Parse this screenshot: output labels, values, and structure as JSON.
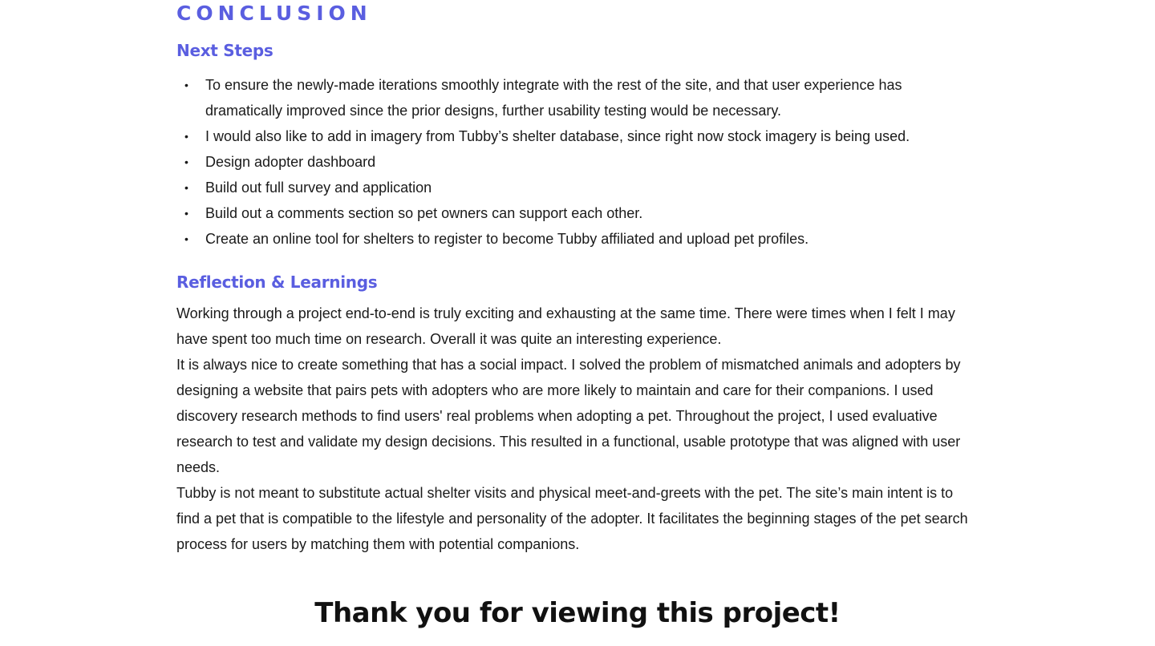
{
  "section": {
    "title": "CONCLUSION"
  },
  "next_steps": {
    "heading": "Next Steps",
    "items": [
      "To ensure the newly-made iterations smoothly integrate with the rest of the site, and that user experience has dramatically improved since the prior designs, further usability testing would be necessary.",
      "I would also like to add in imagery from Tubby’s shelter database, since right now stock imagery is being used.",
      "Design adopter dashboard",
      "Build out full survey and application",
      "Build out a comments section so pet owners can support each other.",
      "Create an online tool for shelters to register to become Tubby affiliated and upload pet profiles."
    ],
    "bullet": "•"
  },
  "reflection": {
    "heading": "Reflection & Learnings",
    "paragraphs": [
      "Working through a project end-to-end is truly exciting and exhausting at the same time. There were times when I felt I may have spent too much time on research. Overall it was quite an interesting experience.",
      "It is always nice to create something that has a social impact. I solved the problem of mismatched animals and adopters by designing a website that pairs pets with adopters who are more likely to maintain and care for their companions. I used discovery research methods to find users' real problems when adopting a pet. Throughout the project, I used evaluative research to test and validate my design decisions. This resulted in a functional, usable prototype that was aligned with user needs.",
      "Tubby is not meant to substitute actual shelter visits and physical meet-and-greets with the pet. The site’s main intent is to find a pet that is compatible to the lifestyle and personality of the adopter. It facilitates the beginning stages of the pet search process for users by matching them with potential companions."
    ]
  },
  "closing": {
    "thanks": "Thank you for viewing this project!"
  },
  "colors": {
    "accent": "#5a5ee0",
    "text": "#1a1a1a",
    "background": "#ffffff"
  }
}
